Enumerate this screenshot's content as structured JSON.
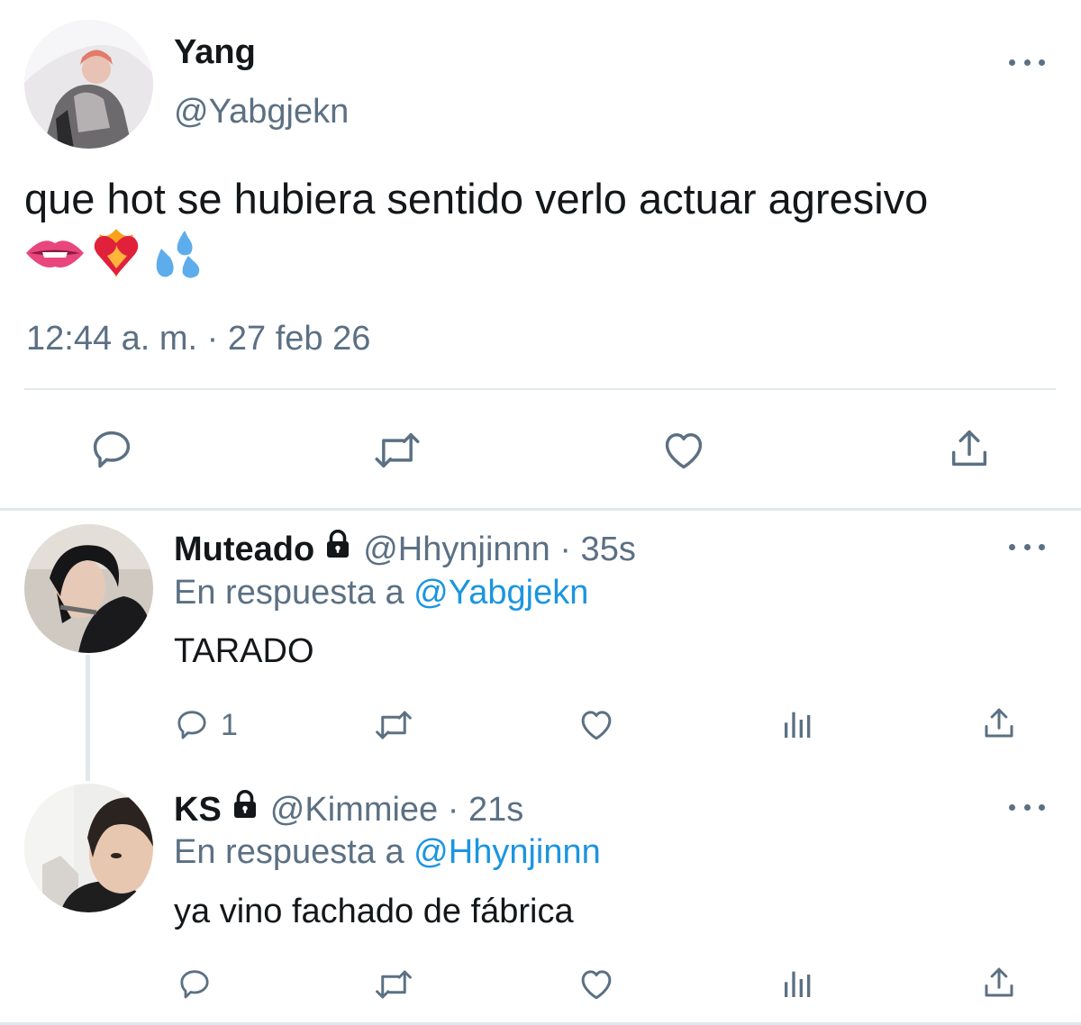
{
  "main_tweet": {
    "author_name": "Yang",
    "author_handle": "@Yabgjekn",
    "text": "que hot se hubiera sentido verlo actuar agresivo",
    "emojis": [
      "biting-lip",
      "heart-on-fire",
      "sweat-droplets"
    ],
    "timestamp": "12:44 a. m. · 27 feb 26",
    "actions": [
      "reply-icon",
      "retweet-icon",
      "like-icon",
      "share-icon"
    ]
  },
  "replies": [
    {
      "author_name": "Muteado",
      "locked": true,
      "handle_time": "@Hhynjinnn · 35s",
      "reply_prefix": "En respuesta a",
      "reply_to": "@Yabgjekn",
      "text": "TARADO",
      "reply_count": "1"
    },
    {
      "author_name": "KS",
      "locked": true,
      "handle_time": "@Kimmiee · 21s",
      "reply_prefix": "En respuesta a",
      "reply_to": "@Hhynjinnn",
      "text": "ya vino fachado de fábrica",
      "reply_count": ""
    }
  ],
  "colors": {
    "text": "#14171a",
    "secondary": "#5b7083",
    "link": "#1b95e0",
    "divider": "#e1e8ed"
  }
}
